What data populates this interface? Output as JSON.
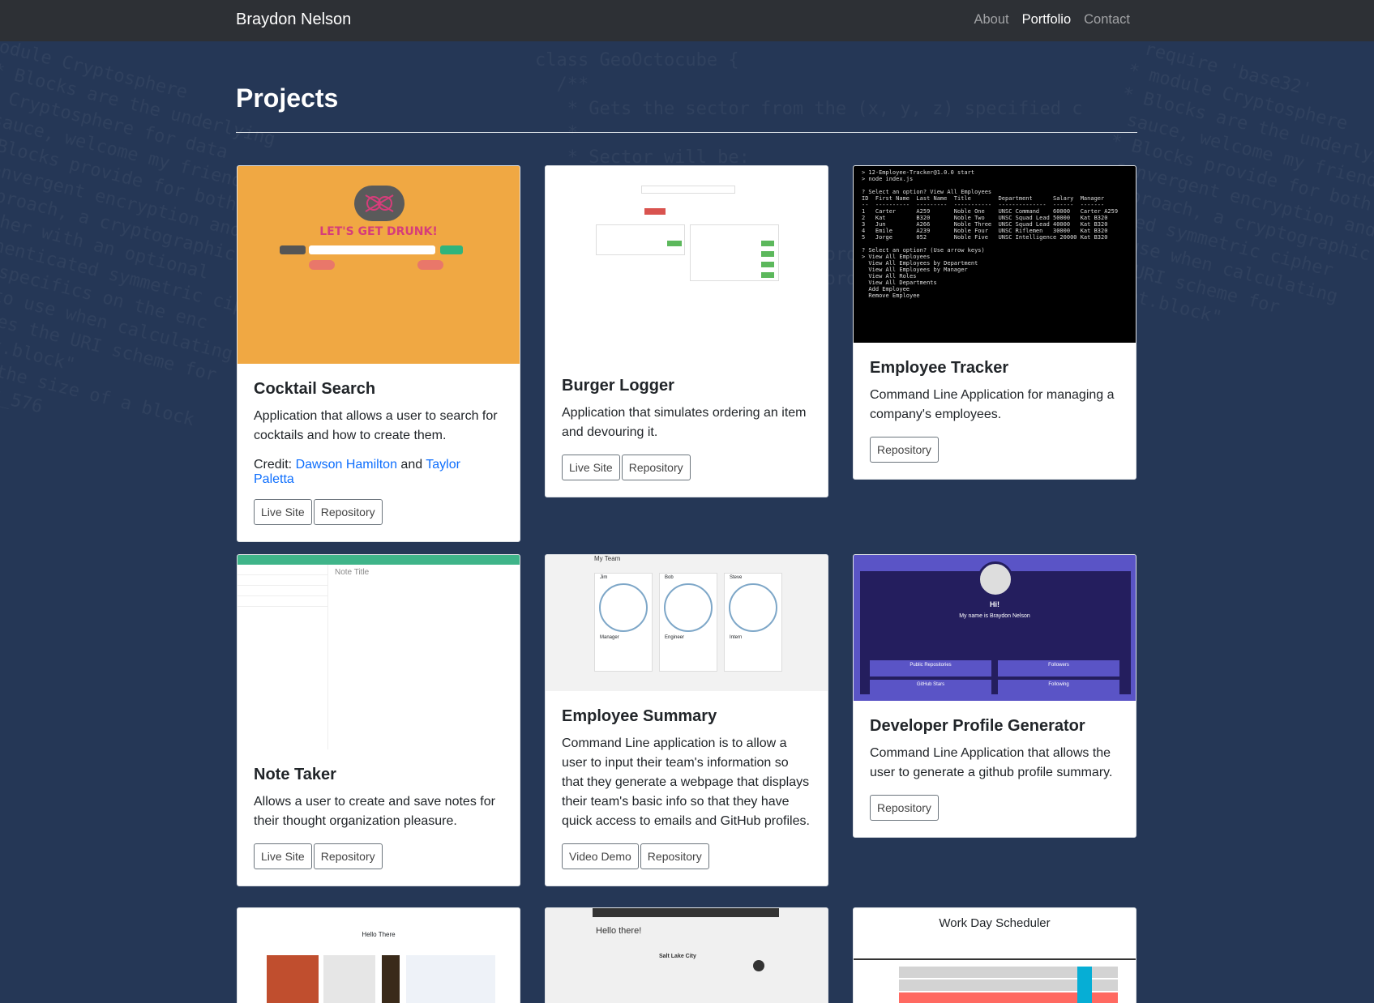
{
  "nav": {
    "brand": "Braydon Nelson",
    "links": [
      {
        "label": "About",
        "active": false
      },
      {
        "label": "Portfolio",
        "active": true
      },
      {
        "label": "Contact",
        "active": false
      }
    ]
  },
  "page": {
    "title": "Projects"
  },
  "projects": [
    {
      "title": "Cocktail Search",
      "description": "Application that allows a user to search for cocktails and how to create them.",
      "credit_prefix": "Credit:",
      "credit_name1": "Dawson Hamilton",
      "credit_and": "and",
      "credit_name2": "Taylor Paletta",
      "image_text": "LET'S GET DRUNK!",
      "btn1": "Live Site",
      "btn2": "Repository"
    },
    {
      "title": "Burger Logger",
      "description": "Application that simulates ordering an item and devouring it.",
      "btn1": "Live Site",
      "btn2": "Repository"
    },
    {
      "title": "Employee Tracker",
      "description": "Command Line Application for managing a company's employees.",
      "btn1": "Repository"
    },
    {
      "title": "Note Taker",
      "description": "Allows a user to create and save notes for their thought organization pleasure.",
      "image_text": "Note Title",
      "btn1": "Live Site",
      "btn2": "Repository"
    },
    {
      "title": "Employee Summary",
      "description": "Command Line application is to allow a user to input their team's information so that they generate a webpage that displays their team's basic info so that they have quick access to emails and GitHub profiles.",
      "image_heading": "My Team",
      "members": [
        {
          "name": "Jim",
          "role": "Manager"
        },
        {
          "name": "Bob",
          "role": "Engineer"
        },
        {
          "name": "Steve",
          "role": "Intern"
        }
      ],
      "btn1": "Video Demo",
      "btn2": "Repository"
    },
    {
      "title": "Developer Profile Generator",
      "description": "Command Line Application that allows the user to generate a github profile summary.",
      "image_hi": "Hi!",
      "image_name": "My name is Braydon Nelson",
      "stats": [
        "Public Repositories",
        "Followers",
        "GitHub Stars",
        "Following"
      ],
      "btn1": "Repository"
    },
    {
      "image_text": "Hello There"
    },
    {
      "image_text": "Hello there!",
      "image_city": "Salt Lake City"
    },
    {
      "image_text": "Work Day Scheduler"
    }
  ],
  "colors": {
    "background": "#253756",
    "navbar": "#2d3035",
    "link": "#0d6efd",
    "cocktail_bg": "#f0a843",
    "devprofile_bg": "#5a54c6"
  }
}
